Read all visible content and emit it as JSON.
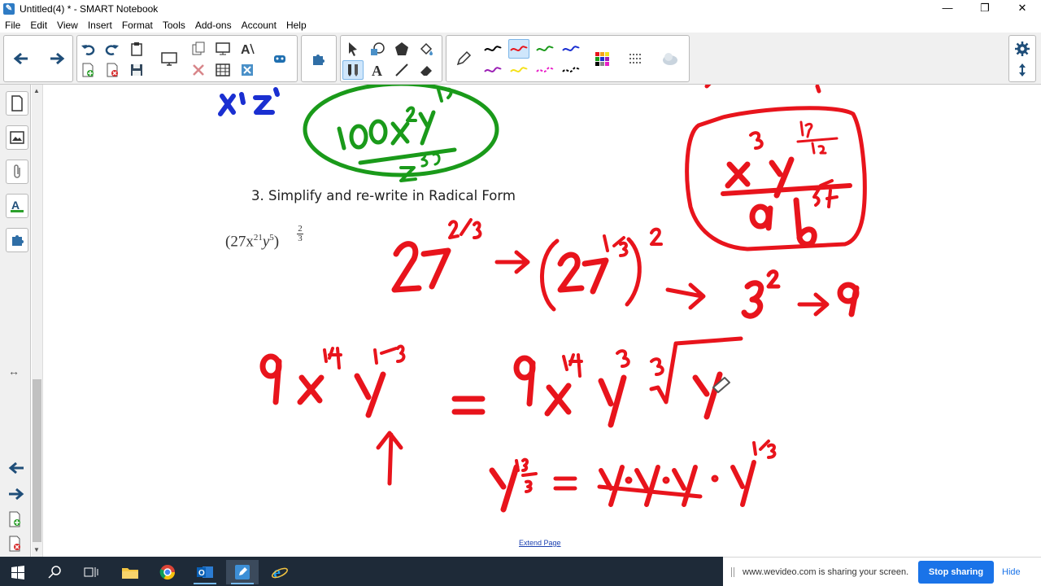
{
  "window": {
    "title": "Untitled(4) * - SMART Notebook",
    "minimize": "—",
    "maximize": "❐",
    "close": "✕"
  },
  "menu": [
    "File",
    "Edit",
    "View",
    "Insert",
    "Format",
    "Tools",
    "Add-ons",
    "Account",
    "Help"
  ],
  "document": {
    "question": "3.   Simplify and re-write in Radical Form",
    "expression_base": "(27x",
    "expression_exp_x": "21",
    "expression_y": "y",
    "expression_exp_y": "5",
    "expression_close": ")",
    "expression_power_num": "2",
    "expression_power_den": "3",
    "extend_link": "Extend Page"
  },
  "handwriting": {
    "top_fraction_num": "100x²y¹⁹",
    "top_fraction_den": "z³⁰",
    "boxed_answer_num": "x³ y¹⁷/₁₂",
    "boxed_answer_den": "a b⁵/⁴",
    "line1": "27²/³ → (27¹/³)² → 3² → 9",
    "line2": "9x¹⁴ y¹⁰/³ = 9x¹⁴ y³ ³√y",
    "line3": "y¹⁰/³ = y·y·y · y¹/³",
    "colors": {
      "red": "#e8141c",
      "green": "#1a9a1a",
      "blue": "#1a2fd1"
    }
  },
  "share": {
    "message": "www.wevideo.com is sharing your screen.",
    "stop_label": "Stop sharing",
    "hide_label": "Hide"
  }
}
